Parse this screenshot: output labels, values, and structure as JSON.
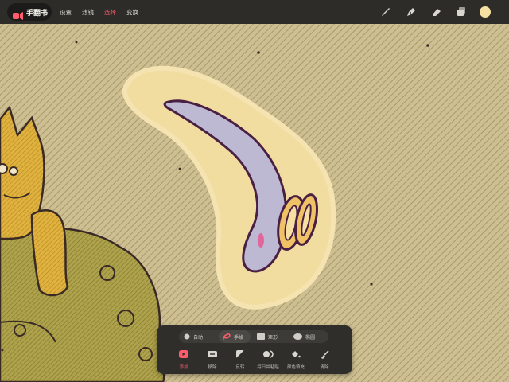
{
  "app": {
    "name": "手翻书"
  },
  "menu": [
    {
      "label": "设置",
      "active": false
    },
    {
      "label": "滤镜",
      "active": false
    },
    {
      "label": "选择",
      "active": true
    },
    {
      "label": "变换",
      "active": false
    }
  ],
  "tools": [
    {
      "icon": "brush-icon"
    },
    {
      "icon": "pen-nib-icon"
    },
    {
      "icon": "eraser-icon"
    },
    {
      "icon": "layers-icon"
    }
  ],
  "current_color": "#f5dfa2",
  "accent_color": "#ff5c6e",
  "selection_modes": [
    {
      "label": "自动",
      "icon": "circle-icon",
      "active": false
    },
    {
      "label": "手绘",
      "icon": "lasso-icon",
      "active": true
    },
    {
      "label": "矩形",
      "icon": "rectangle-icon",
      "active": false
    },
    {
      "label": "椭圆",
      "icon": "ellipse-icon",
      "active": false
    }
  ],
  "selection_actions": [
    {
      "label": "添加",
      "icon": "add-selection-icon",
      "active": true
    },
    {
      "label": "移除",
      "icon": "remove-selection-icon",
      "active": false
    },
    {
      "label": "反转",
      "icon": "invert-icon",
      "active": false
    },
    {
      "label": "捋日并粘贴",
      "icon": "copy-paste-icon",
      "active": false
    },
    {
      "label": "颜色填充",
      "icon": "fill-icon",
      "active": false
    },
    {
      "label": "清除",
      "icon": "clear-icon",
      "active": false
    }
  ]
}
